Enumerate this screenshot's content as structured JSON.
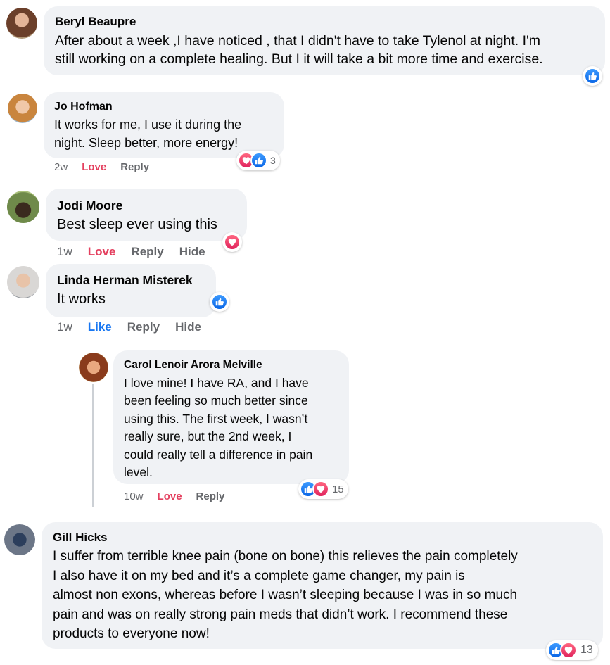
{
  "colors": {
    "bubble": "#f0f2f5",
    "love": "#e4405f",
    "like": "#1877f2",
    "meta": "#65676b"
  },
  "comments": [
    {
      "name": "Beryl Beaupre",
      "text": "After about a week ,I have noticed , that I didn't have to take Tylenol at night. I'm\nstill working on a complete healing. But I it will take a bit more time and exercise.",
      "reactions": {
        "icons": [
          "like-icon"
        ],
        "count": ""
      }
    },
    {
      "name": "Jo Hofman",
      "text": "It works for me, I use it during the\nnight. Sleep better, more energy!",
      "time": "2w",
      "reaction_label": "Love",
      "reply": "Reply",
      "reactions": {
        "icons": [
          "love-icon",
          "like-icon"
        ],
        "count": "3"
      }
    },
    {
      "name": "Jodi Moore",
      "text": "Best sleep ever using this",
      "time": "1w",
      "reaction_label": "Love",
      "reply": "Reply",
      "hide": "Hide",
      "reactions": {
        "icons": [
          "love-icon"
        ],
        "count": ""
      }
    },
    {
      "name": "Linda Herman Misterek",
      "text": "It works",
      "time": "1w",
      "reaction_label": "Like",
      "reply": "Reply",
      "hide": "Hide",
      "reactions": {
        "icons": [
          "like-icon"
        ],
        "count": ""
      }
    },
    {
      "name": "Carol Lenoir Arora Melville",
      "text": "I love mine! I have RA, and I have\nbeen feeling so much better since\nusing this. The first week, I wasn’t\nreally sure, but the 2nd week, I\ncould really tell a difference in pain\nlevel.",
      "time": "10w",
      "reaction_label": "Love",
      "reply": "Reply",
      "reactions": {
        "icons": [
          "like-icon",
          "love-icon"
        ],
        "count": "15"
      }
    },
    {
      "name": "Gill Hicks",
      "text": "I suffer from terrible knee pain (bone on bone) this relieves the pain completely\nI also have it on my bed and it’s a complete game changer, my pain is\nalmost non exons, whereas before I wasn’t sleeping because I was in so much\npain and was on really strong pain meds that didn’t work. I recommend these\nproducts to everyone now!",
      "reactions": {
        "icons": [
          "like-icon",
          "love-icon"
        ],
        "count": "13"
      }
    }
  ]
}
